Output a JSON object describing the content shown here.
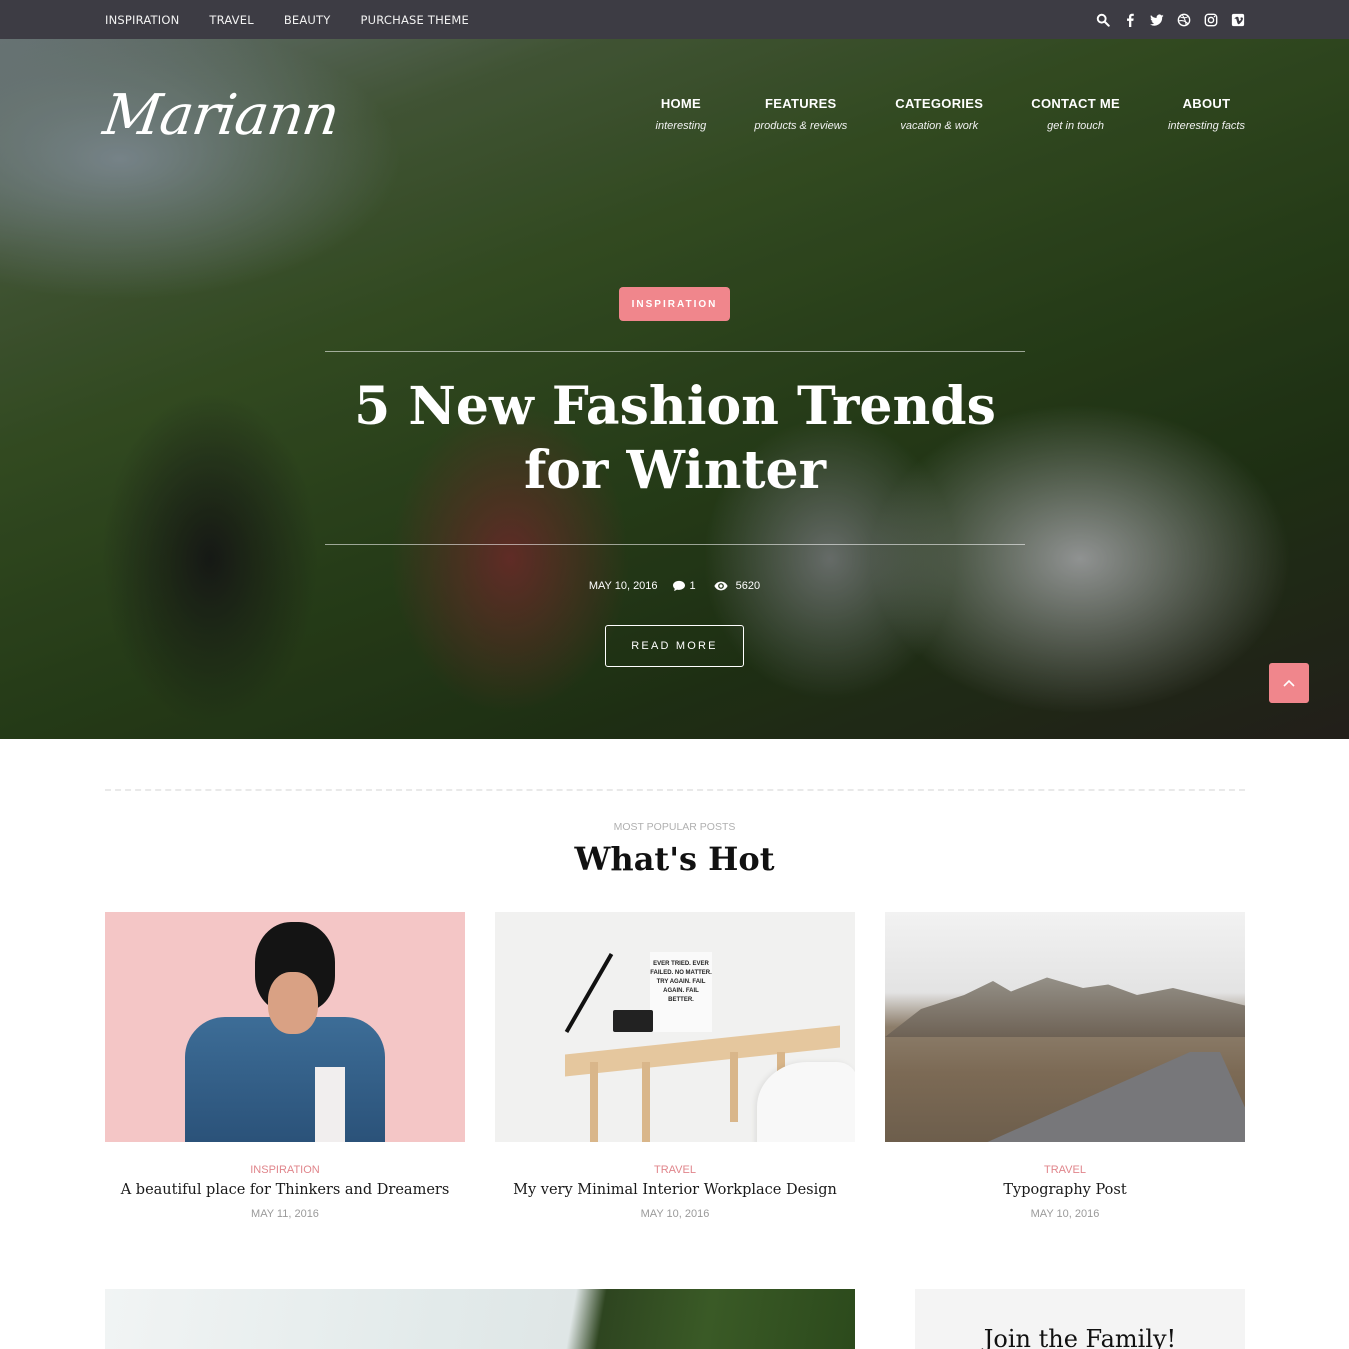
{
  "topbar": {
    "links": [
      "INSPIRATION",
      "TRAVEL",
      "BEAUTY",
      "PURCHASE THEME"
    ],
    "icons": [
      "search-icon",
      "facebook-icon",
      "twitter-icon",
      "dribbble-icon",
      "instagram-icon",
      "vimeo-icon"
    ]
  },
  "brand": {
    "logo": "Mariann"
  },
  "nav": [
    {
      "title": "HOME",
      "subtitle": "interesting"
    },
    {
      "title": "FEATURES",
      "subtitle": "products & reviews"
    },
    {
      "title": "CATEGORIES",
      "subtitle": "vacation & work"
    },
    {
      "title": "CONTACT ME",
      "subtitle": "get in touch"
    },
    {
      "title": "ABOUT",
      "subtitle": "interesting facts"
    }
  ],
  "hero": {
    "category": "INSPIRATION",
    "title": "5 New Fashion Trends for Winter",
    "date": "MAY 10, 2016",
    "comments": "1",
    "views": "5620",
    "read_more": "READ MORE"
  },
  "popular": {
    "eyebrow": "MOST POPULAR POSTS",
    "title": "What's Hot",
    "posts": [
      {
        "category": "INSPIRATION",
        "title": "A beautiful place for Thinkers and Dreamers",
        "date": "MAY 11, 2016",
        "image": "woman-denim-jacket-photo"
      },
      {
        "category": "TRAVEL",
        "title": "My very Minimal Interior Workplace Design",
        "date": "MAY 10, 2016",
        "image": "minimal-desk-photo",
        "poster_text": "EVER TRIED. EVER FAILED. NO MATTER. TRY AGAIN. FAIL AGAIN. FAIL BETTER."
      },
      {
        "category": "TRAVEL",
        "title": "Typography Post",
        "date": "MAY 10, 2016",
        "image": "mountain-road-photo"
      }
    ]
  },
  "sidebar": {
    "join_title": "Join the Family!"
  },
  "colors": {
    "accent": "#f0868c",
    "topbar_bg": "#3d3c44",
    "category_text": "#e0858b",
    "muted": "#9a9a9a"
  }
}
